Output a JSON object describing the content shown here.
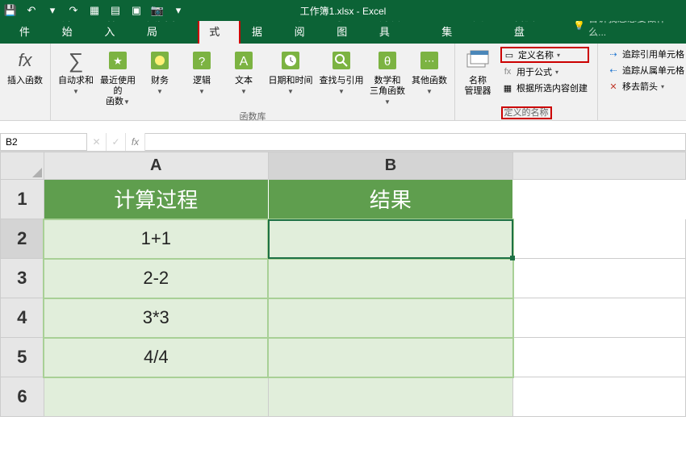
{
  "app": {
    "title": "工作簿1.xlsx - Excel"
  },
  "qat": {
    "save": "💾",
    "undo": "↶",
    "redo": "↷"
  },
  "tabs": {
    "file": "文件",
    "home": "开始",
    "insert": "插入",
    "layout": "页面布局",
    "formula": "公式",
    "data": "数据",
    "review": "审阅",
    "view": "视图",
    "dev": "开发工具",
    "pdf": "PDF工具集",
    "baidu": "百度网盘"
  },
  "tellme": "告诉我您想要做什么...",
  "ribbon": {
    "insert_fn": "插入函数",
    "autosum": "自动求和",
    "recent": "最近使用的\n函数",
    "financial": "财务",
    "logical": "逻辑",
    "text": "文本",
    "datetime": "日期和时间",
    "lookup": "查找与引用",
    "math": "数学和\n三角函数",
    "other": "其他函数",
    "lib_label": "函数库",
    "name_mgr": "名称\n管理器",
    "def_name": "定义名称",
    "use_formula": "用于公式",
    "create_sel": "根据所选内容创建",
    "names_label": "定义的名称",
    "trace_prec": "追踪引用单元格",
    "trace_dep": "追踪从属单元格",
    "remove_arrows": "移去箭头"
  },
  "namebox": "B2",
  "sheet": {
    "cols": [
      "A",
      "B"
    ],
    "rows": [
      "1",
      "2",
      "3",
      "4",
      "5",
      "6"
    ],
    "header": {
      "A": "计算过程",
      "B": "结果"
    },
    "data": {
      "A2": "1+1",
      "A3": "2-2",
      "A4": "3*3",
      "A5": "4/4",
      "B2": "",
      "B3": "",
      "B4": "",
      "B5": ""
    }
  }
}
